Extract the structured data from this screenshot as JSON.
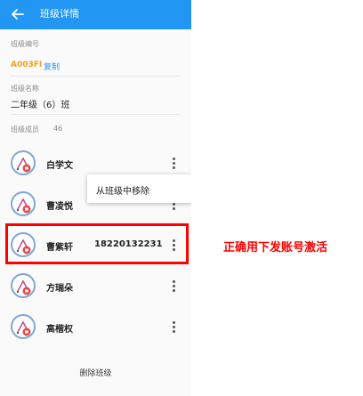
{
  "app_bar": {
    "title": "班级详情",
    "back_icon": "back-arrow-icon",
    "color": "#2196f3"
  },
  "class_info": {
    "code_label": "班级编号",
    "code": "A003FI",
    "copy_label": "复制",
    "name_label": "班级名称",
    "name": "二年级（6）班",
    "members_label": "班级成员",
    "members_count": "46"
  },
  "members": [
    {
      "name": "白学文",
      "phone": "",
      "avatar_icon": "student-avatar-icon",
      "more_icon": "more-vert-icon"
    },
    {
      "name": "曹凌悦",
      "phone": "",
      "avatar_icon": "student-avatar-icon",
      "more_icon": "more-vert-icon"
    },
    {
      "name": "曹紫轩",
      "phone": "18220132231",
      "avatar_icon": "student-avatar-icon",
      "more_icon": "more-vert-icon"
    },
    {
      "name": "方瑞朵",
      "phone": "",
      "avatar_icon": "student-avatar-icon",
      "more_icon": "more-vert-icon"
    },
    {
      "name": "高楷权",
      "phone": "",
      "avatar_icon": "student-avatar-icon",
      "more_icon": "more-vert-icon"
    }
  ],
  "popup_menu": {
    "items": [
      "从班级中移除"
    ]
  },
  "delete_class_label": "删除班级",
  "annotation": {
    "text": "正确用下发账号激活",
    "color": "#ff0000"
  }
}
